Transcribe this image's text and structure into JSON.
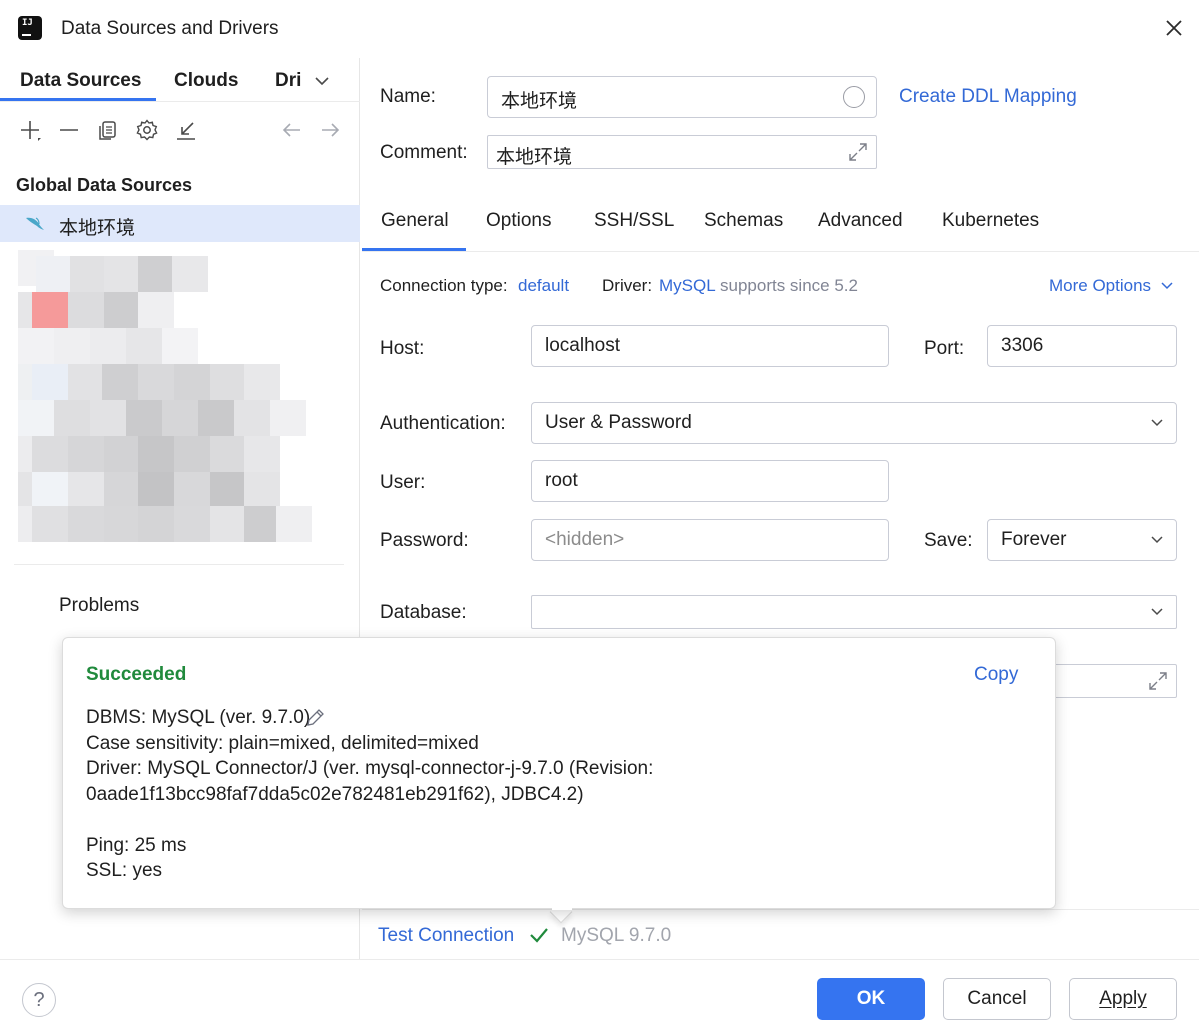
{
  "window": {
    "title": "Data Sources and Drivers"
  },
  "left": {
    "tabs": [
      "Data Sources",
      "Clouds",
      "Dri"
    ],
    "section_header": "Global Data Sources",
    "selected_source": "本地环境",
    "problems_label": "Problems"
  },
  "form": {
    "name_label": "Name:",
    "name_value": "本地环境",
    "create_ddl_link": "Create DDL Mapping",
    "comment_label": "Comment:",
    "comment_value": "本地环境",
    "tabs": [
      "General",
      "Options",
      "SSH/SSL",
      "Schemas",
      "Advanced",
      "Kubernetes"
    ],
    "active_tab": "General",
    "connection_type_label": "Connection type:",
    "connection_type_value": "default",
    "driver_label": "Driver:",
    "driver_value": "MySQL",
    "driver_note": "supports since 5.2",
    "more_options": "More Options",
    "host_label": "Host:",
    "host_value": "localhost",
    "port_label": "Port:",
    "port_value": "3306",
    "auth_label": "Authentication:",
    "auth_value": "User & Password",
    "user_label": "User:",
    "user_value": "root",
    "password_label": "Password:",
    "password_placeholder": "<hidden>",
    "save_label": "Save:",
    "save_value": "Forever",
    "database_label": "Database:",
    "database_value": ""
  },
  "popup": {
    "status": "Succeeded",
    "copy": "Copy",
    "lines": [
      "DBMS: MySQL (ver. 9.7.0)",
      "Case sensitivity: plain=mixed, delimited=mixed",
      "Driver: MySQL Connector/J (ver. mysql-connector-j-9.7.0 (Revision:",
      "0aade1f13bcc98faf7dda5c02e782481eb291f62), JDBC4.2)",
      "Ping: 25 ms",
      "SSL: yes"
    ]
  },
  "footer": {
    "test_connection": "Test Connection",
    "test_result": "MySQL 9.7.0",
    "ok": "OK",
    "cancel": "Cancel",
    "apply": "Apply",
    "help": "?"
  },
  "colors": {
    "accent": "#3574f0",
    "link": "#3369d6",
    "success": "#208a3c",
    "selection": "#dfe8fb"
  }
}
